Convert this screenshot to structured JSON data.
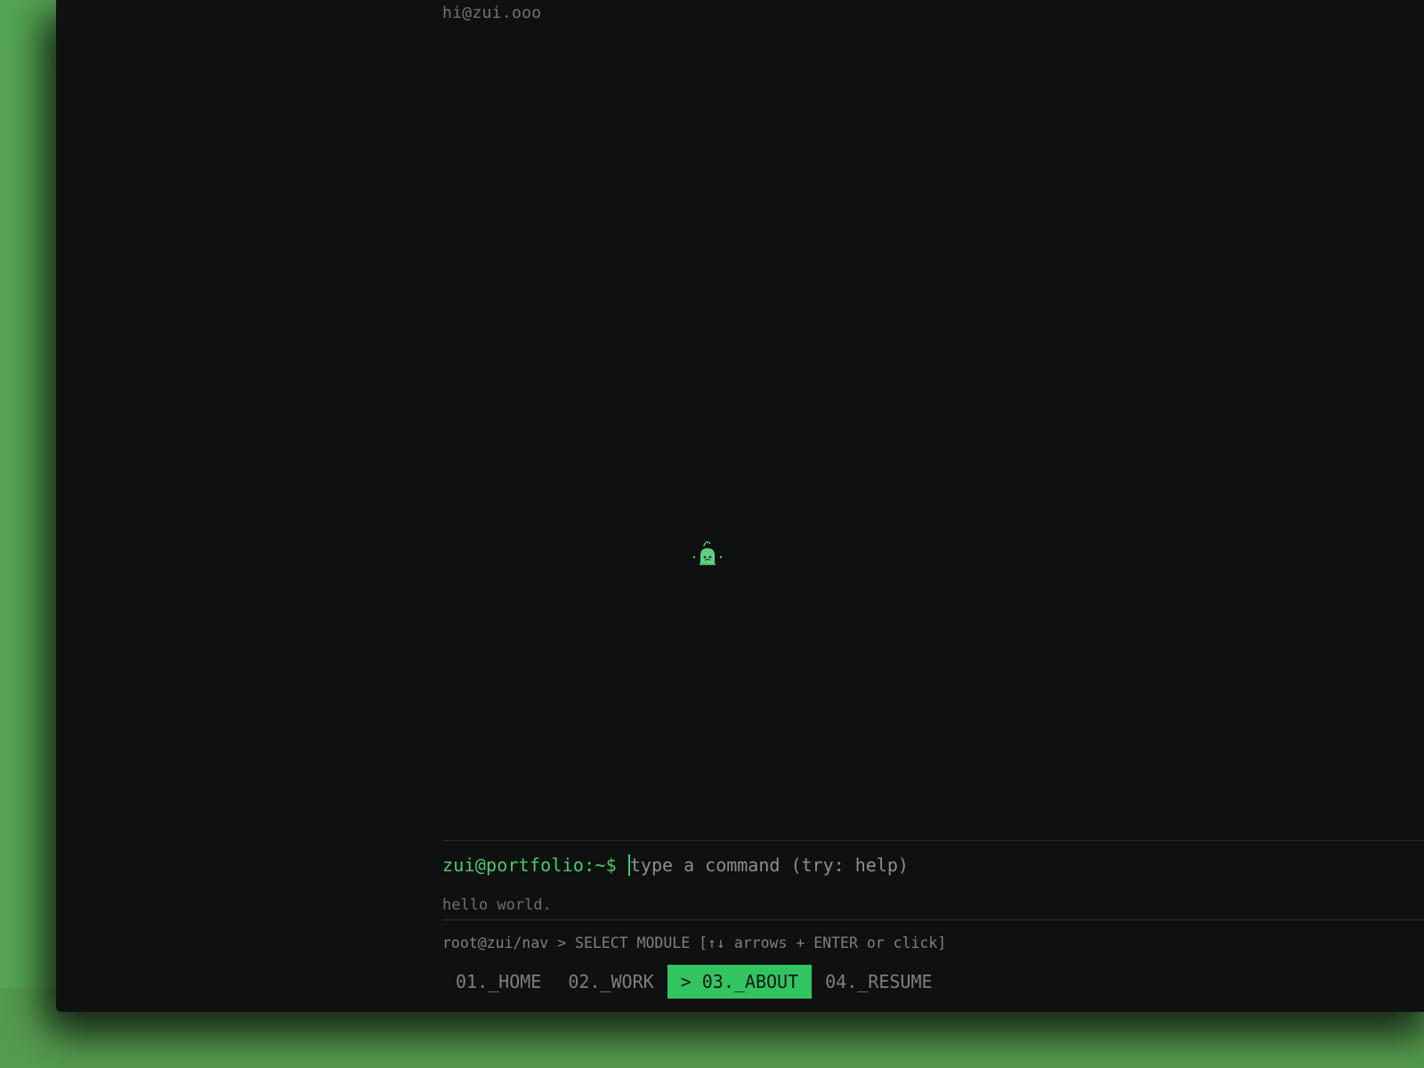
{
  "header": {
    "email": "hi@zui.ooo"
  },
  "terminal": {
    "prompt": "zui@portfolio:~$",
    "input_value": "",
    "input_placeholder": "type a command (try: help)",
    "output": "hello world."
  },
  "nav": {
    "hint": "root@zui/nav > SELECT MODULE [↑↓ arrows + ENTER or click]",
    "items": [
      {
        "label": "01._HOME",
        "active": false
      },
      {
        "label": "02._WORK",
        "active": false
      },
      {
        "label": "> 03._ABOUT",
        "active": true
      },
      {
        "label": "04._RESUME",
        "active": false
      }
    ]
  },
  "colors": {
    "background": "#55a453",
    "terminal_bg": "#0f1111",
    "accent": "#33c462",
    "prompt": "#4cc86c"
  },
  "icons": {
    "mascot": "bot-mascot-icon"
  }
}
